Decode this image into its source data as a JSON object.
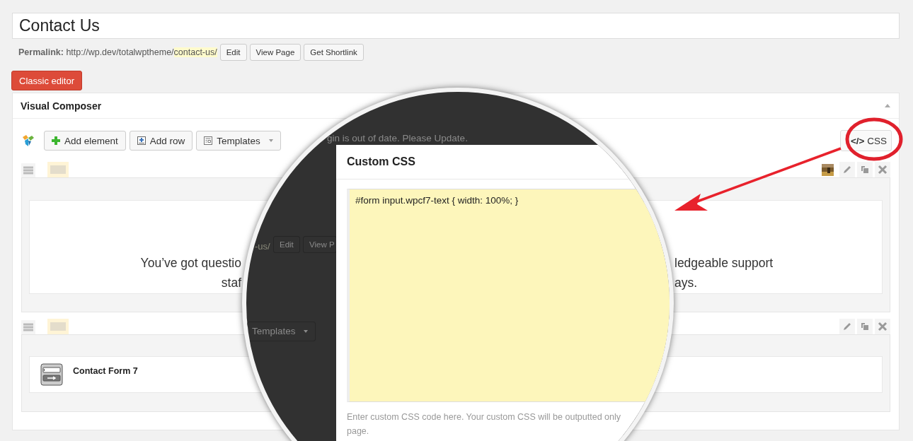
{
  "post_title": {
    "value": "Contact Us"
  },
  "permalink": {
    "label": "Permalink:",
    "url_base": "http://wp.dev/totalwptheme/",
    "slug": "contact-us/",
    "buttons": [
      "Edit",
      "View Page",
      "Get Shortlink"
    ]
  },
  "classic_editor_button": "Classic editor",
  "composer": {
    "title": "Visual Composer",
    "toolbar": [
      {
        "label": "Add element",
        "kind": "add"
      },
      {
        "label": "Add row",
        "kind": "row"
      },
      {
        "label": "Templates",
        "kind": "dropdown"
      }
    ],
    "css_button": {
      "icon_text": "</>",
      "label": "CSS"
    },
    "rows": [
      {
        "kind": "text",
        "has_picture": true,
        "lines": [
          {
            "left": "You’ve got questio",
            "right": "ledgeable support"
          },
          {
            "left": "staf",
            "right": "ays."
          }
        ]
      },
      {
        "kind": "form",
        "has_picture": false,
        "title": "Contact Form 7"
      }
    ]
  },
  "magnifier": {
    "notice": "gin is out of date. Please Update.",
    "ghost_slug": "-us/",
    "ghost_buttons": [
      "Edit",
      "View P"
    ],
    "ghost_dropdown": "Templates",
    "modal": {
      "title": "Custom CSS",
      "value": "#form input.wpcf7-text { width: 100%; }",
      "help_lines": [
        "Enter custom CSS code here. Your custom CSS will be outputted only",
        "page."
      ]
    }
  }
}
